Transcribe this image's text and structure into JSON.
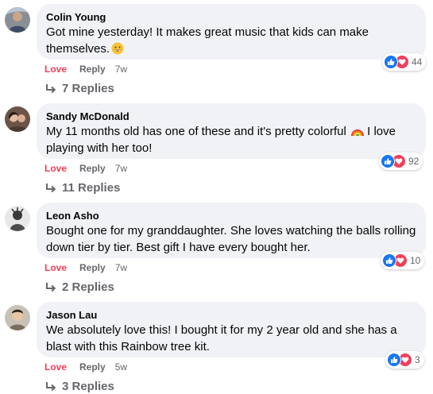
{
  "colors": {
    "bubble": "#f0f2f5",
    "love": "#f33e58",
    "like": "#1877f2",
    "meta": "#65676b"
  },
  "actions": {
    "love_label": "Love",
    "reply_label": "Reply"
  },
  "comments": [
    {
      "author": "Colin Young",
      "text": "Got mine yesterday! It makes great music that kids can make themselves.",
      "emoji": "grinning-face-emoji",
      "reaction_count": "44",
      "time": "7w",
      "replies_label": "7 Replies"
    },
    {
      "author": "Sandy McDonald",
      "text_before": "My 11 months old has one of these and it's pretty colorful",
      "emoji": "rainbow-emoji",
      "text_after": " I love playing with her too!",
      "reaction_count": "92",
      "time": "7w",
      "replies_label": "11 Replies"
    },
    {
      "author": "Leon Asho",
      "text": "Bought one for my granddaughter. She loves watching the balls rolling down tier by tier. Best gift I have every bought her.",
      "reaction_count": "10",
      "time": "7w",
      "replies_label": "2 Replies"
    },
    {
      "author": "Jason Lau",
      "text": "We absolutely love this! I bought it for my 2 year old and she has a blast with this Rainbow tree kit.",
      "reaction_count": "3",
      "time": "5w",
      "replies_label": "3 Replies"
    }
  ]
}
